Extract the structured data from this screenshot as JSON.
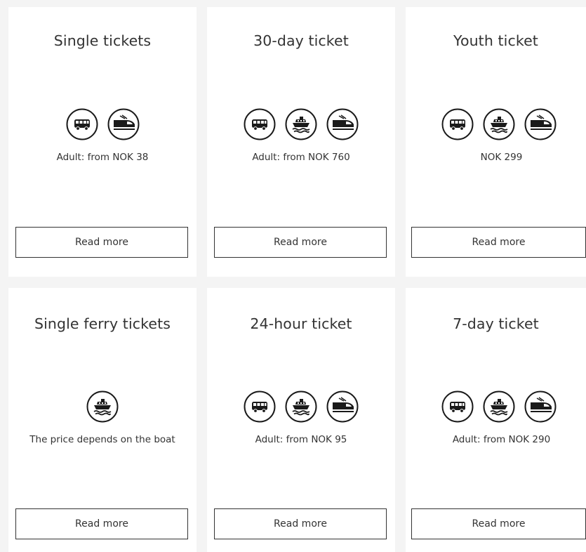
{
  "tickets": [
    {
      "title": "Single tickets",
      "icons": [
        "bus-icon",
        "train-icon"
      ],
      "price": "Adult: from NOK 38",
      "button": "Read more"
    },
    {
      "title": "30-day ticket",
      "icons": [
        "bus-icon",
        "ferry-icon",
        "train-icon"
      ],
      "price": "Adult: from NOK 760",
      "button": "Read more"
    },
    {
      "title": "Youth ticket",
      "icons": [
        "bus-icon",
        "ferry-icon",
        "train-icon"
      ],
      "price": "NOK 299",
      "button": "Read more"
    },
    {
      "title": "Single ferry tickets",
      "icons": [
        "ferry-icon"
      ],
      "price": "The price depends on the boat",
      "button": "Read more"
    },
    {
      "title": "24-hour ticket",
      "icons": [
        "bus-icon",
        "ferry-icon",
        "train-icon"
      ],
      "price": "Adult: from NOK 95",
      "button": "Read more"
    },
    {
      "title": "7-day ticket",
      "icons": [
        "bus-icon",
        "ferry-icon",
        "train-icon"
      ],
      "price": "Adult: from NOK 290",
      "button": "Read more"
    }
  ],
  "colors": {
    "page_background": "#f4f4f4",
    "card_background": "#ffffff",
    "text": "#333333",
    "icon": "#1a1a1a"
  }
}
